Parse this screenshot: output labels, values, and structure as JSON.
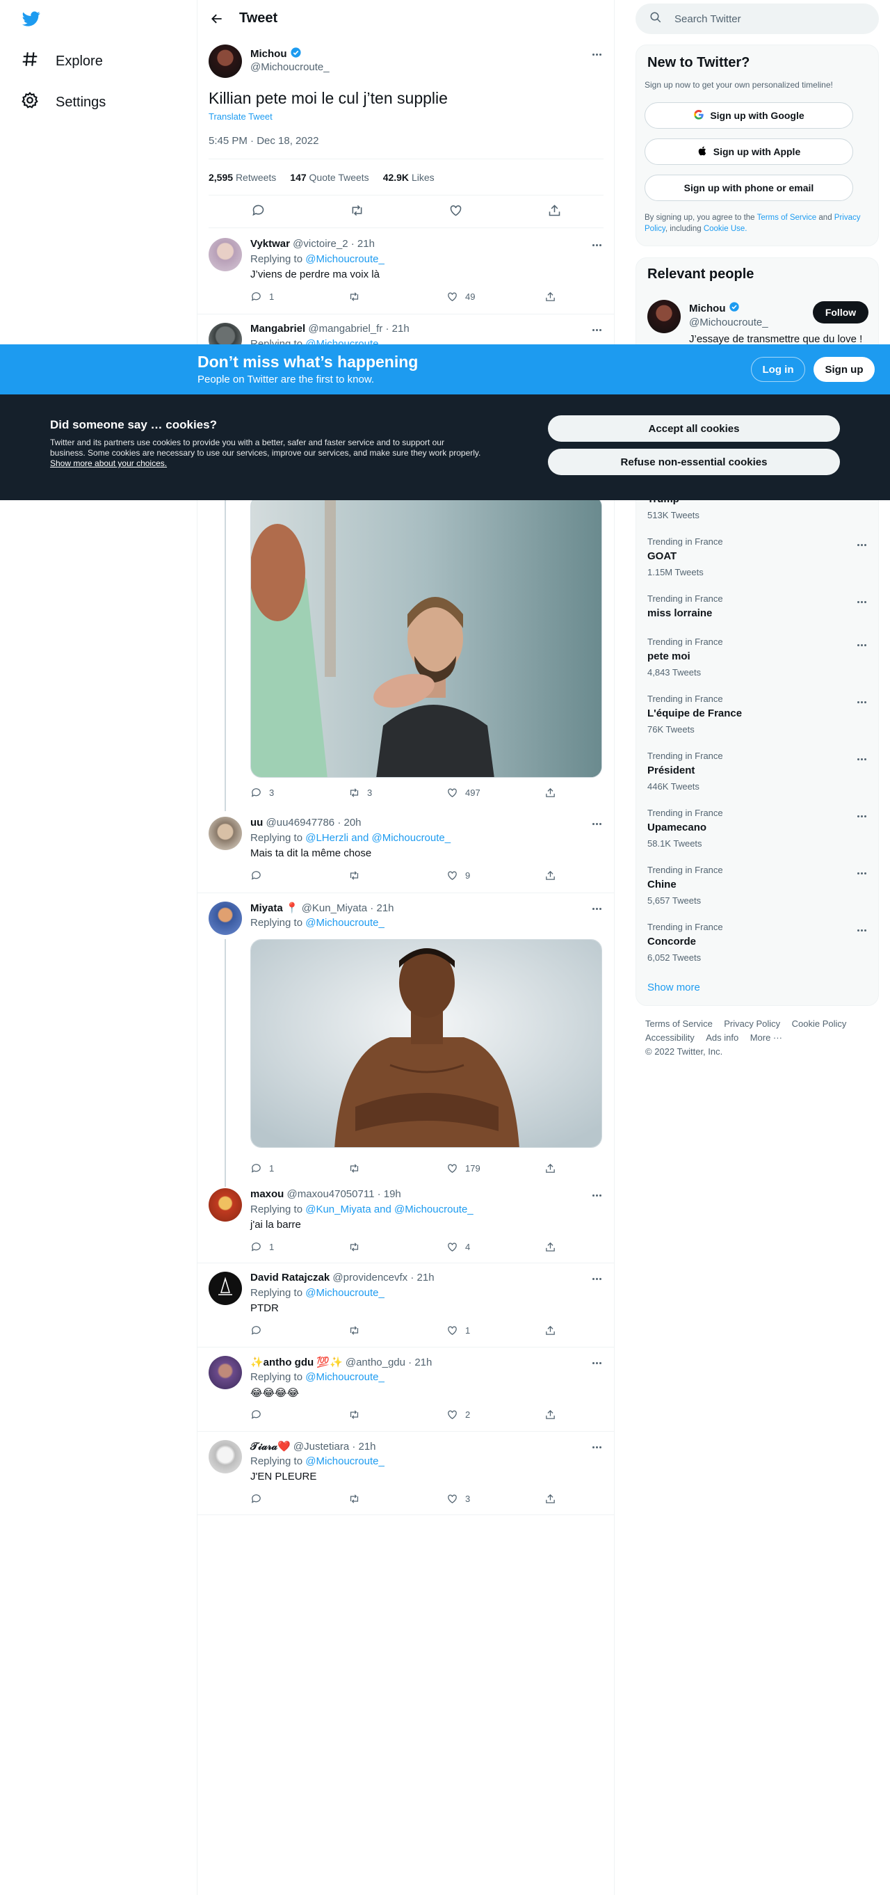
{
  "nav": {
    "items": [
      {
        "label": "Explore",
        "icon": "hashtag-icon"
      },
      {
        "label": "Settings",
        "icon": "gear-icon"
      }
    ]
  },
  "header": {
    "title": "Tweet"
  },
  "tweet": {
    "name": "Michou",
    "handle": "@Michoucroute_",
    "text": "Killian pete moi le cul j’ten supplie",
    "translate": "Translate Tweet",
    "time": "5:45 PM · Dec 18, 2022",
    "stats": {
      "retweets_num": "2,595",
      "retweets_label": "Retweets",
      "quotes_num": "147",
      "quotes_label": "Quote Tweets",
      "likes_num": "42.9K",
      "likes_label": "Likes"
    }
  },
  "replies": [
    {
      "name": "Vyktwar",
      "handle": "@victoire_2 · 21h",
      "replying": "Replying to",
      "to": "@Michoucroute_",
      "text": "J’viens de perdre ma voix là",
      "replies": "1",
      "retweets": "",
      "likes": "49"
    },
    {
      "name": "Mangabriel",
      "handle": "@mangabriel_fr · 21h",
      "replying": "Replying to",
      "to": "@Michoucroute_",
      "text": "",
      "replies": "3",
      "retweets": "3",
      "likes": "497"
    },
    {
      "name": "uu",
      "handle": "@uu46947786 · 20h",
      "replying": "Replying to",
      "to": "@LHerzli and @Michoucroute_",
      "text": "Mais ta dit la même chose",
      "replies": "",
      "retweets": "",
      "likes": "9"
    },
    {
      "name": "Miyata 📍",
      "handle": "@Kun_Miyata · 21h",
      "replying": "Replying to",
      "to": "@Michoucroute_",
      "text": "",
      "replies": "1",
      "retweets": "",
      "likes": "179"
    },
    {
      "name": "maxou",
      "handle": "@maxou47050711 · 19h",
      "replying": "Replying to",
      "to": "@Kun_Miyata and @Michoucroute_",
      "text": "j'ai la barre",
      "replies": "1",
      "retweets": "",
      "likes": "4"
    },
    {
      "name": "David Ratajczak",
      "handle": "@providencevfx · 21h",
      "replying": "Replying to",
      "to": "@Michoucroute_",
      "text": "PTDR",
      "replies": "",
      "retweets": "",
      "likes": "1"
    },
    {
      "name": "✨antho gdu 💯✨",
      "handle": "@antho_gdu · 21h",
      "replying": "Replying to",
      "to": "@Michoucroute_",
      "text": "😂😂😂😂",
      "replies": "",
      "retweets": "",
      "likes": "2"
    },
    {
      "name": "𝒯𝒾𝒶𝓇𝒶❤️",
      "handle": "@Justetiara · 21h",
      "replying": "Replying to",
      "to": "@Michoucroute_",
      "text": "J'EN PLEURE",
      "replies": "",
      "retweets": "",
      "likes": "3"
    }
  ],
  "search": {
    "placeholder": "Search Twitter"
  },
  "new_to_twitter": {
    "title": "New to Twitter?",
    "subtitle": "Sign up now to get your own personalized timeline!",
    "google": "Sign up with Google",
    "apple": "Sign up with Apple",
    "phone": "Sign up with phone or email",
    "legal_1": "By signing up, you agree to the",
    "tos": "Terms of Service",
    "and": "and",
    "privacy": "Privacy Policy",
    "including": ", including",
    "cookie": "Cookie Use."
  },
  "relevant": {
    "title": "Relevant people",
    "name": "Michou",
    "handle": "@Michoucroute_",
    "follow": "Follow",
    "bio": "J’essaye de transmettre que du love !"
  },
  "trends": [
    {
      "category": "",
      "name": "Trump",
      "count": "513K Tweets"
    },
    {
      "category": "Trending in France",
      "name": "GOAT",
      "count": "1.15M Tweets"
    },
    {
      "category": "Trending in France",
      "name": "miss lorraine",
      "count": ""
    },
    {
      "category": "Trending in France",
      "name": "pete moi",
      "count": "4,843 Tweets"
    },
    {
      "category": "Trending in France",
      "name": "L'équipe de France",
      "count": "76K Tweets"
    },
    {
      "category": "Trending in France",
      "name": "Président",
      "count": "446K Tweets"
    },
    {
      "category": "Trending in France",
      "name": "Upamecano",
      "count": "58.1K Tweets"
    },
    {
      "category": "Trending in France",
      "name": "Chine",
      "count": "5,657 Tweets"
    },
    {
      "category": "Trending in France",
      "name": "Concorde",
      "count": "6,052 Tweets"
    }
  ],
  "show_more": "Show more",
  "footer": {
    "links": [
      "Terms of Service",
      "Privacy Policy",
      "Cookie Policy",
      "Accessibility",
      "Ads info",
      "More ···"
    ],
    "copyright": "© 2022 Twitter, Inc."
  },
  "signup_banner": {
    "title": "Don’t miss what’s happening",
    "subtitle": "People on Twitter are the first to know.",
    "login": "Log in",
    "signup": "Sign up"
  },
  "cookie_banner": {
    "title": "Did someone say … cookies?",
    "body": "Twitter and its partners use cookies to provide you with a better, safer and faster service and to support our business. Some cookies are necessary to use our services, improve our services, and make sure they work properly.",
    "more_link": "Show more about your choices.",
    "accept": "Accept all cookies",
    "refuse": "Refuse non-essential cookies"
  },
  "colors": {
    "accent": "#1d9bf0",
    "text": "#0f1419",
    "muted": "#536471",
    "dark": "#15202b"
  }
}
